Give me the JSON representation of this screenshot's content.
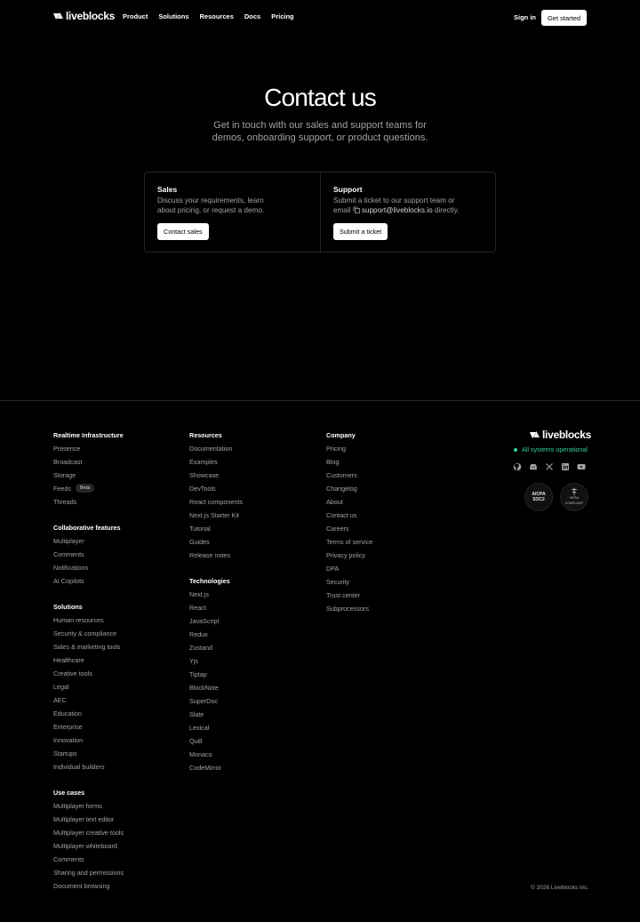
{
  "brand": {
    "name": "liveblocks"
  },
  "nav": {
    "links": [
      "Product",
      "Solutions",
      "Resources",
      "Docs",
      "Pricing"
    ],
    "sign_in": "Sign in",
    "get_started": "Get started"
  },
  "hero": {
    "title": "Contact us",
    "subtitle_line1": "Get in touch with our sales and support teams for",
    "subtitle_line2": "demos, onboarding support, or product questions."
  },
  "cards": {
    "sales": {
      "title": "Sales",
      "desc_line1": "Discuss your requirements, learn",
      "desc_line2": "about pricing, or request a demo.",
      "button": "Contact sales"
    },
    "support": {
      "title": "Support",
      "desc_line1": "Submit a ticket to our support team or",
      "desc_pre": "email",
      "email": "support@liveblocks.io",
      "desc_post": "directly.",
      "button": "Submit a ticket"
    }
  },
  "footer": {
    "col1": [
      {
        "heading": "Realtime Infrastructure",
        "items": [
          "Presence",
          "Broadcast",
          "Storage",
          "Feeds",
          "Threads"
        ]
      },
      {
        "heading": "Collaborative features",
        "items": [
          "Multiplayer",
          "Comments",
          "Notifications",
          "AI Copilots"
        ]
      },
      {
        "heading": "Solutions",
        "items": [
          "Human resources",
          "Security & compliance",
          "Sales & marketing tools",
          "Healthcare",
          "Creative tools",
          "Legal",
          "AEC",
          "Education",
          "Enterprise",
          "Innovation",
          "Startups",
          "Individual builders"
        ]
      },
      {
        "heading": "Use cases",
        "items": [
          "Multiplayer forms",
          "Multiplayer text editor",
          "Multiplayer creative tools",
          "Multiplayer whiteboard",
          "Comments",
          "Sharing and permissions",
          "Document browsing"
        ]
      }
    ],
    "feeds_badge": "Beta",
    "col2": [
      {
        "heading": "Resources",
        "items": [
          "Documentation",
          "Examples",
          "Showcase",
          "DevTools",
          "React components",
          "Next.js Starter Kit",
          "Tutorial",
          "Guides",
          "Release notes"
        ]
      },
      {
        "heading": "Technologies",
        "items": [
          "Next.js",
          "React",
          "JavaScript",
          "Redux",
          "Zustand",
          "Yjs",
          "Tiptap",
          "BlockNote",
          "SuperDoc",
          "Slate",
          "Lexical",
          "Quill",
          "Monaco",
          "CodeMirror"
        ]
      }
    ],
    "col3": [
      {
        "heading": "Company",
        "items": [
          "Pricing",
          "Blog",
          "Customers",
          "Changelog",
          "About",
          "Contact us",
          "Careers",
          "Terms of service",
          "Privacy policy",
          "DPA",
          "Security",
          "Trust center",
          "Subprocessors"
        ]
      }
    ],
    "status": "All systems operational",
    "status_color": "#34d399",
    "socials": [
      "github-icon",
      "discord-icon",
      "x-icon",
      "linkedin-icon",
      "youtube-icon"
    ],
    "badges": {
      "soc2_top": "AICPA",
      "soc2_bottom": "SOC2",
      "hipaa_text": "HIPAA",
      "hipaa_sub": "COMPLIANT"
    },
    "copyright": "© 2026 Liveblocks Inc."
  }
}
